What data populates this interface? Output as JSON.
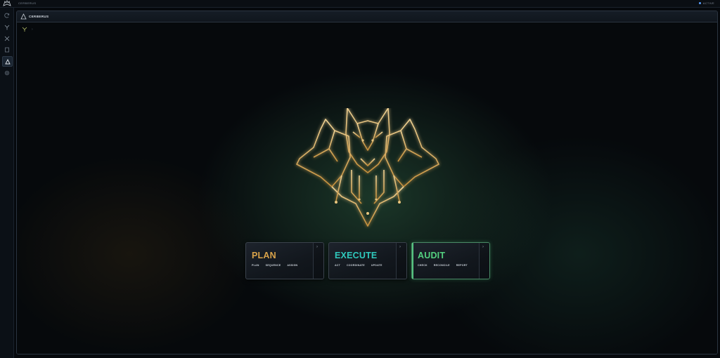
{
  "topbar": {
    "app_name": "CERBERUS",
    "right_text": "ACTIVE"
  },
  "rail": {
    "items": [
      {
        "icon": "refresh-icon"
      },
      {
        "icon": "share-icon"
      },
      {
        "icon": "tools-icon"
      },
      {
        "icon": "document-icon"
      },
      {
        "icon": "triangle-icon",
        "active": true
      },
      {
        "icon": "settings-icon"
      }
    ]
  },
  "panel": {
    "title": "CERBERUS"
  },
  "cards": [
    {
      "title": "PLAN",
      "color": "#d8a24a",
      "subs": [
        "PLAN",
        "SEQUENCE",
        "ASSIGN"
      ]
    },
    {
      "title": "EXECUTE",
      "color": "#2fc9bd",
      "subs": [
        "ACT",
        "COORDINATE",
        "UPDATE"
      ]
    },
    {
      "title": "AUDIT",
      "color": "#53d07f",
      "subs": [
        "CHECK",
        "RECONCILE",
        "REPORT"
      ]
    }
  ],
  "colors": {
    "gold": "#d8a24a",
    "teal": "#2fc9bd",
    "green": "#53d07f"
  }
}
